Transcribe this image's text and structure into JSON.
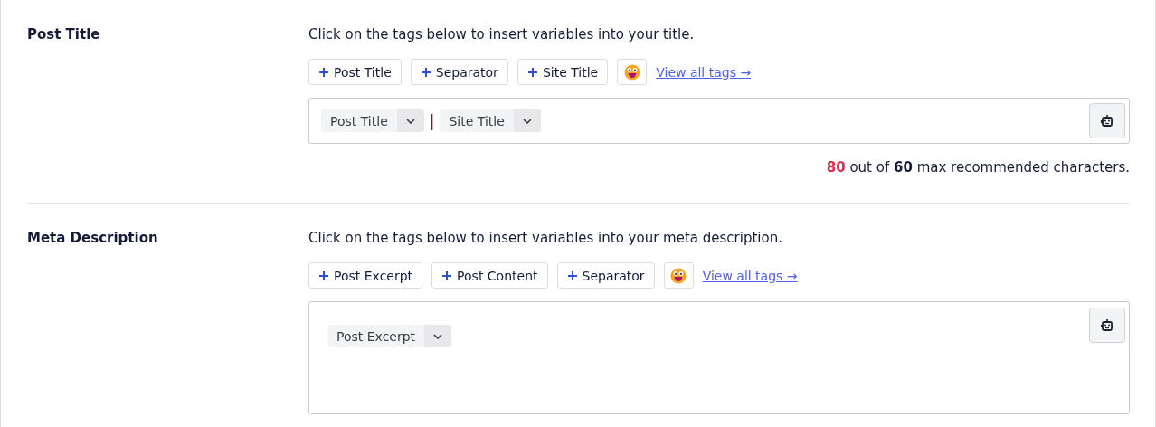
{
  "sections": [
    {
      "label": "Post Title",
      "hint": "Click on the tags below to insert variables into your title.",
      "tag_buttons": [
        "Post Title",
        "Separator",
        "Site Title"
      ],
      "view_all": "View all tags →",
      "editor": {
        "multiline": false,
        "tokens": [
          {
            "kind": "tag",
            "text": "Post Title"
          },
          {
            "kind": "separator",
            "text": "|"
          },
          {
            "kind": "tag",
            "text": "Site Title"
          }
        ]
      },
      "counter": {
        "count": "80",
        "over": true,
        "rest": " out of **60** max recommended characters."
      }
    },
    {
      "label": "Meta Description",
      "hint": "Click on the tags below to insert variables into your meta description.",
      "tag_buttons": [
        "Post Excerpt",
        "Post Content",
        "Separator"
      ],
      "view_all": "View all tags →",
      "editor": {
        "multiline": true,
        "tokens": [
          {
            "kind": "tag",
            "text": "Post Excerpt"
          }
        ]
      }
    }
  ]
}
